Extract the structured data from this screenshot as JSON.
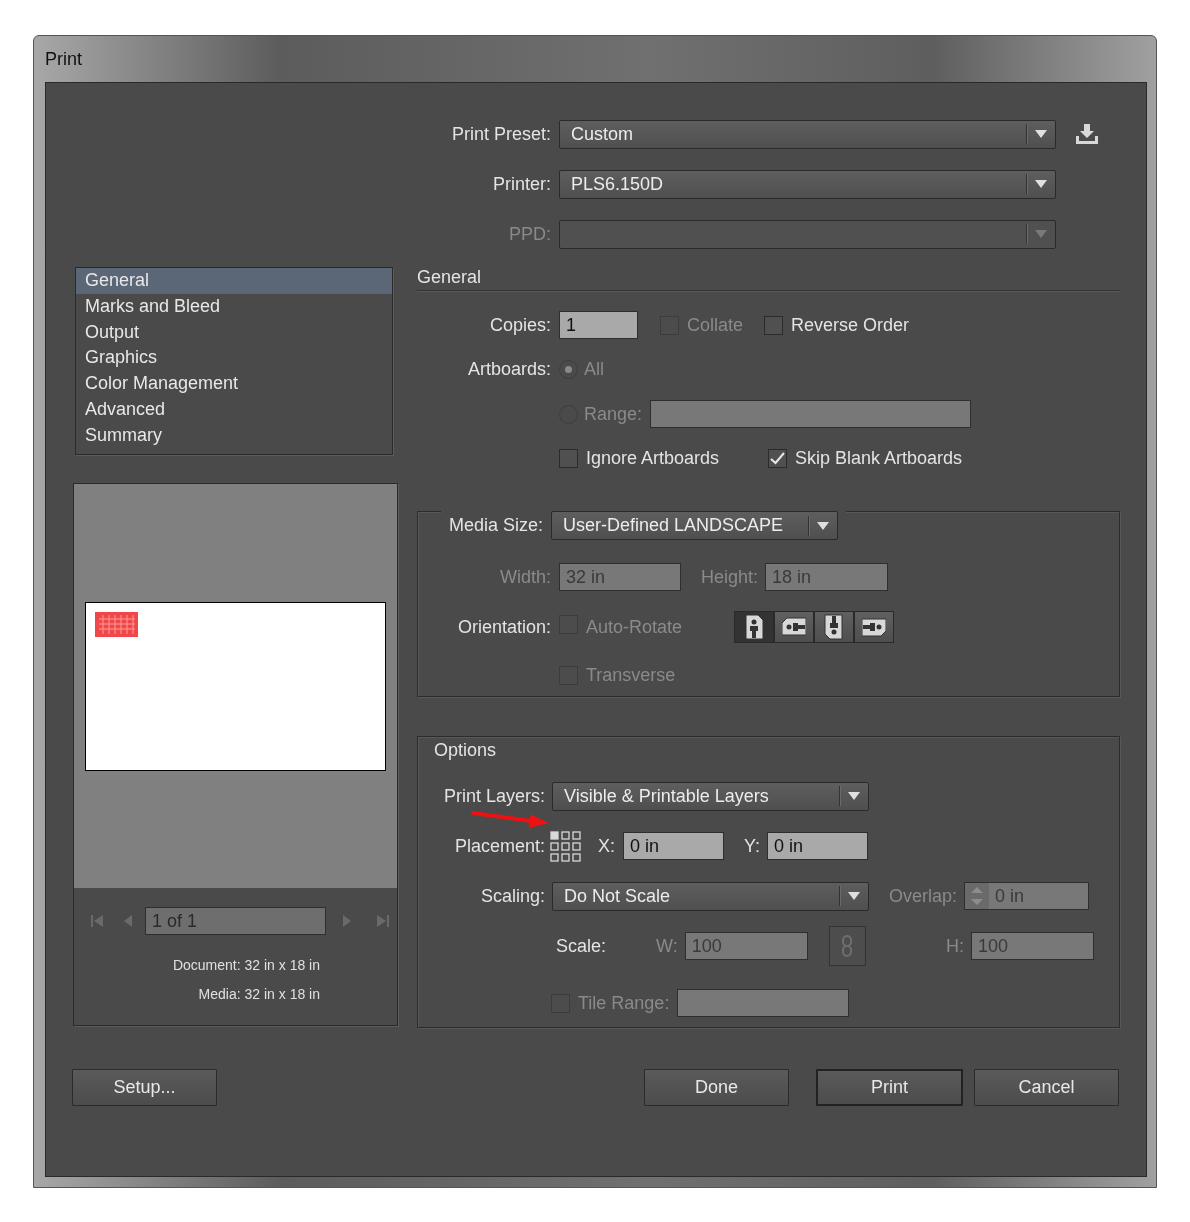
{
  "window": {
    "title": "Print"
  },
  "print_preset": {
    "label": "Print Preset:",
    "value": "Custom"
  },
  "printer": {
    "label": "Printer:",
    "value": "PLS6.150D"
  },
  "ppd": {
    "label": "PPD:",
    "disabled": true
  },
  "sidebar": {
    "items": [
      {
        "label": "General",
        "selected": true
      },
      {
        "label": "Marks and Bleed",
        "selected": false
      },
      {
        "label": "Output",
        "selected": false
      },
      {
        "label": "Graphics",
        "selected": false
      },
      {
        "label": "Color Management",
        "selected": false
      },
      {
        "label": "Advanced",
        "selected": false
      },
      {
        "label": "Summary",
        "selected": false
      }
    ]
  },
  "preview": {
    "page_field": "1 of 1",
    "document": "Document: 32 in x 18 in",
    "media": "Media: 32 in x 18 in"
  },
  "general": {
    "title": "General",
    "copies": {
      "label": "Copies:",
      "value": "1"
    },
    "collate": {
      "label": "Collate",
      "checked": false,
      "disabled": true
    },
    "reverse_order": {
      "label": "Reverse Order",
      "checked": false,
      "disabled": false
    },
    "artboards": {
      "label": "Artboards:",
      "options": [
        {
          "label": "All",
          "selected": true,
          "disabled": true
        },
        {
          "label": "Range:",
          "selected": false,
          "disabled": true
        }
      ]
    },
    "range_field": {
      "disabled": true
    },
    "ignore_artboards": {
      "label": "Ignore Artboards",
      "checked": false,
      "disabled": false
    },
    "skip_blank_artboards": {
      "label": "Skip Blank Artboards",
      "checked": true,
      "disabled": false
    }
  },
  "media": {
    "label": "Media Size:",
    "value": "User-Defined LANDSCAPE",
    "width": {
      "label": "Width:",
      "value": "32 in",
      "disabled": true
    },
    "height": {
      "label": "Height:",
      "value": "18 in",
      "disabled": true
    },
    "orientation": {
      "label": "Orientation:",
      "auto_rotate": {
        "label": "Auto-Rotate",
        "checked": false,
        "disabled": true
      },
      "buttons": [
        {
          "kind": "portrait",
          "selected": true
        },
        {
          "kind": "landscape",
          "selected": false
        },
        {
          "kind": "portrait-flipped",
          "selected": false
        },
        {
          "kind": "landscape-flipped",
          "selected": false
        }
      ]
    },
    "transverse": {
      "label": "Transverse",
      "checked": false,
      "disabled": true
    }
  },
  "options": {
    "title": "Options",
    "print_layers": {
      "label": "Print Layers:",
      "value": "Visible & Printable Layers"
    },
    "placement": {
      "label": "Placement:",
      "x": {
        "label": "X:",
        "value": "0 in"
      },
      "y": {
        "label": "Y:",
        "value": "0 in"
      }
    },
    "scaling": {
      "label": "Scaling:",
      "value": "Do Not Scale"
    },
    "overlap": {
      "label": "Overlap:",
      "value": "0 in",
      "disabled": true
    },
    "scale": {
      "label": "Scale:",
      "w": {
        "label": "W:",
        "value": "100",
        "disabled": true
      },
      "h": {
        "label": "H:",
        "value": "100",
        "disabled": true
      }
    },
    "tile_range": {
      "label": "Tile Range:",
      "checked": false,
      "disabled": true
    }
  },
  "buttons": [
    {
      "label": "Setup...",
      "default": false
    },
    {
      "label": "Done",
      "default": false
    },
    {
      "label": "Print",
      "default": true
    },
    {
      "label": "Cancel",
      "default": false
    }
  ]
}
